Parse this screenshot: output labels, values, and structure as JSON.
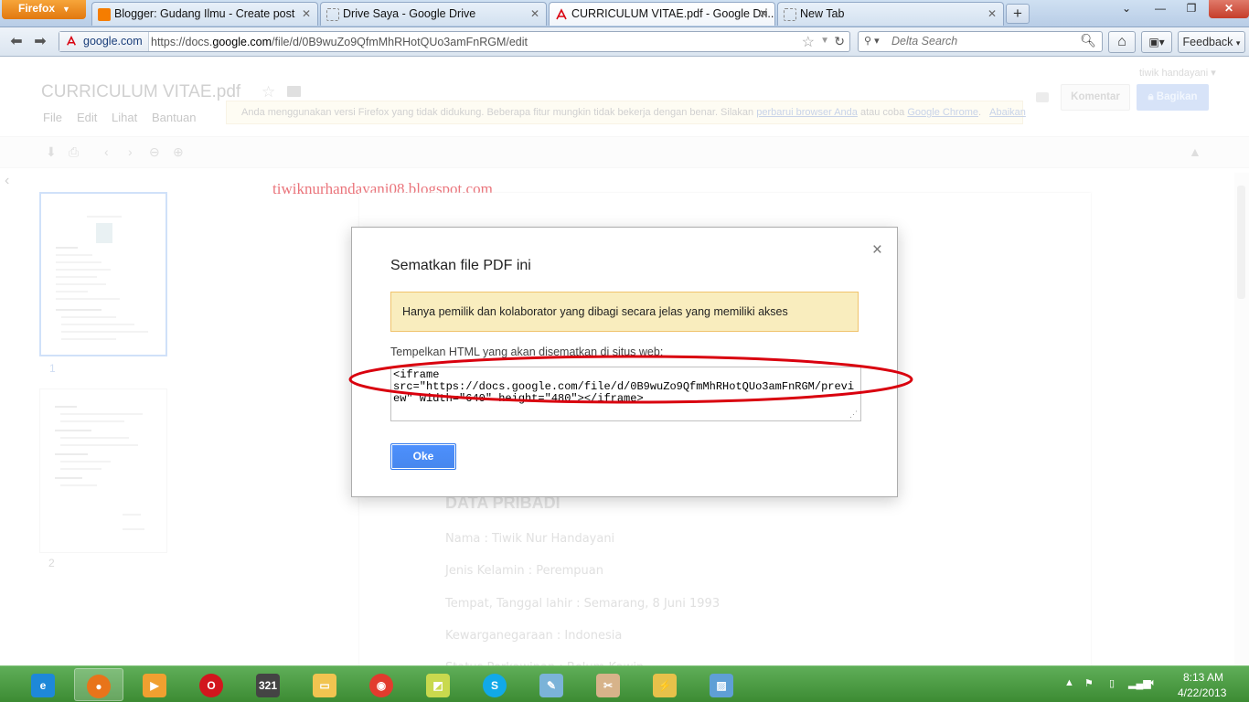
{
  "browser": {
    "app_button": "Firefox",
    "tabs": [
      {
        "label": "Blogger: Gudang Ilmu - Create post"
      },
      {
        "label": "Drive Saya - Google Drive"
      },
      {
        "label": "CURRICULUM VITAE.pdf - Google Dri..."
      },
      {
        "label": "New Tab"
      }
    ],
    "new_tab": "+",
    "site_identity": "google.com",
    "url_prefix": "https://docs.",
    "url_domain": "google.com",
    "url_suffix": "/file/d/0B9wuZo9QfmMhRHotQUo3amFnRGM/edit",
    "search_placeholder": "Delta Search",
    "feedback_label": "Feedback"
  },
  "drive": {
    "doc_title": "CURRICULUM VITAE.pdf",
    "menu": [
      "File",
      "Edit",
      "Lihat",
      "Bantuan"
    ],
    "notice": {
      "text": "Anda menggunakan versi Firefox yang tidak didukung. Beberapa fitur mungkin tidak bekerja dengan benar. Silakan",
      "link1": "perbarui browser Anda",
      "mid": "atau coba",
      "link2": "Google Chrome",
      "dot": ".",
      "link3": "Abaikan"
    },
    "user": "tiwik handayani",
    "comment_label": "Komentar",
    "share_label": "Bagikan",
    "thumbnails": [
      {
        "num": "1"
      },
      {
        "num": "2"
      }
    ],
    "watermark": "tiwiknurhandayani08.blogspot.com",
    "page": {
      "heading": "DATA PRIBADI",
      "fields": [
        "Nama : Tiwik Nur Handayani",
        "Jenis Kelamin : Perempuan",
        "Tempat, Tanggal lahir : Semarang, 8 Juni 1993",
        "Kewarganegaraan : Indonesia",
        "Status Perkawinan : Belum Kawin"
      ]
    }
  },
  "dialog": {
    "title": "Sematkan file PDF ini",
    "warning": "Hanya pemilik dan kolaborator yang dibagi secara jelas yang memiliki akses",
    "label": "Tempelkan HTML yang akan disematkan di situs web:",
    "embed_code": "<iframe src=\"https://docs.google.com/file/d/0B9wuZo9QfmMhRHotQUo3amFnRGM/preview\" width=\"640\" height=\"480\"></iframe>",
    "ok_label": "Oke",
    "close_symbol": "×"
  },
  "taskbar": {
    "time": "8:13 AM",
    "date": "4/22/2013"
  },
  "colors": {
    "annotation_red": "#d9000e",
    "primary_blue": "#4d90fe",
    "warning_bg": "#f9edbe",
    "taskbar_green": "#4a9c42"
  }
}
